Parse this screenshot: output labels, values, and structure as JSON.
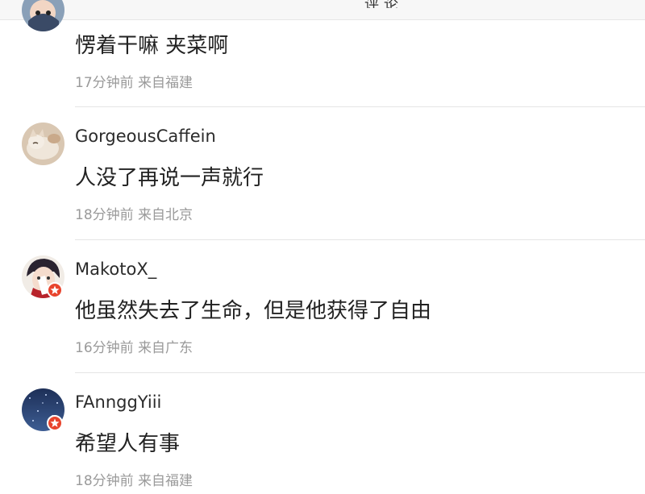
{
  "header": {
    "back_icon": "chevron-left-icon",
    "title_partial": "评论"
  },
  "comments": [
    {
      "username": "",
      "avatar": "cartoon-avatar",
      "verified": false,
      "content": "愣着干嘛 夹菜啊",
      "time": "17分钟前",
      "location": "来自福建"
    },
    {
      "username": "GorgeousCaffein",
      "avatar": "cat-avatar",
      "verified": false,
      "content": "人没了再说一声就行",
      "time": "18分钟前",
      "location": "来自北京"
    },
    {
      "username": "MakotoX_",
      "avatar": "anime-avatar",
      "verified": true,
      "content": "他虽然失去了生命，但是他获得了自由",
      "time": "16分钟前",
      "location": "来自广东"
    },
    {
      "username": "FAnnggYiii",
      "avatar": "night-sky-avatar",
      "verified": true,
      "content": "希望人有事",
      "time": "18分钟前",
      "location": "来自福建"
    }
  ],
  "colors": {
    "badge": "#e8442d",
    "meta_text": "#9a9a9a",
    "divider": "#e5e5e5"
  }
}
